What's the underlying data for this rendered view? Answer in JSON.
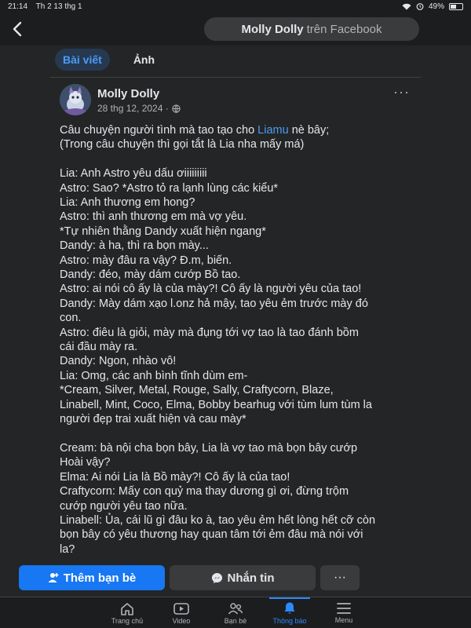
{
  "status": {
    "time": "21:14",
    "date": "Th 2 13 thg 1",
    "battery": "49%",
    "battery_level": 0.49
  },
  "header": {
    "title_bold": "Molly Dolly",
    "title_rest": "trên Facebook"
  },
  "tabs": [
    {
      "label": "Bài viết",
      "active": true
    },
    {
      "label": "Ảnh",
      "active": false
    }
  ],
  "post": {
    "author": "Molly Dolly",
    "date": "28 thg 12, 2024 ·",
    "lines": [
      "Câu chuyện người tình mà tao tạo cho |Liamu| nè bây;",
      "(Trong câu chuyện thì gọi tắt là Lia nha mấy má)",
      "",
      "Lia: Anh Astro yêu dấu ơiiiiiiiii",
      "Astro: Sao? *Astro tỏ ra lạnh lùng các kiểu*",
      "Lia: Anh thương em hong?",
      "Astro: thì anh thương em mà vợ yêu.",
      "*Tự nhiên thằng Dandy xuất hiện ngang*",
      "Dandy: à ha, thì ra bọn mày...",
      "Astro: mày đâu ra vậy? Đ.m, biến.",
      "Dandy: đéo, mày dám cướp Bồ tao.",
      "Astro: ai nói cô ấy là của mày?! Cô ấy là người yêu của tao!",
      "Dandy: Mày dám xạo l.onz hả mậy, tao yêu ẻm trước mày đó",
      "con.",
      "Astro: điêu là giỏi, mày mà đụng tới vợ tao là tao đánh bồm",
      "cái đầu mày ra.",
      "Dandy: Ngon, nhào vô!",
      "Lia: Omg, các anh bình tĩnh dùm em-",
      "*Cream, Silver, Metal, Rouge, Sally, Craftycorn, Blaze,",
      "Linabell, Mint, Coco, Elma, Bobby bearhug với tùm lum tùm la",
      "người đẹp trai xuất hiện và cau mày*",
      "",
      "Cream: bà nội cha bọn bây, Lia là vợ tao mà bọn bây cướp",
      "Hoài vậy?",
      "Elma: Ai nói Lia là Bồ mày?! Cô ấy là của tao!",
      "Craftycorn: Mấy con quỷ ma thay dương gì ơi, đừng trộm",
      "cướp người yêu tao nữa.",
      "Linabell: Ủa, cái lũ gì đâu ko à, tao yêu ẻm hết lòng hết cỡ còn",
      "bọn bây có yêu thương hay quan tâm tới ẻm đâu mà nói với",
      "la?"
    ],
    "more_label": "···"
  },
  "actions": {
    "add_friend": "Thêm bạn bè",
    "message": "Nhắn tin",
    "more": "···"
  },
  "bottom_nav": [
    {
      "label": "Trang chủ",
      "icon": "home-icon",
      "active": false
    },
    {
      "label": "Video",
      "icon": "video-icon",
      "active": false
    },
    {
      "label": "Bạn bè",
      "icon": "friends-icon",
      "active": false
    },
    {
      "label": "Thông báo",
      "icon": "bell-icon",
      "active": true
    },
    {
      "label": "Menu",
      "icon": "menu-icon",
      "active": false
    }
  ],
  "colors": {
    "accent": "#1877f2",
    "link": "#4b9cf5",
    "background": "#242526"
  }
}
